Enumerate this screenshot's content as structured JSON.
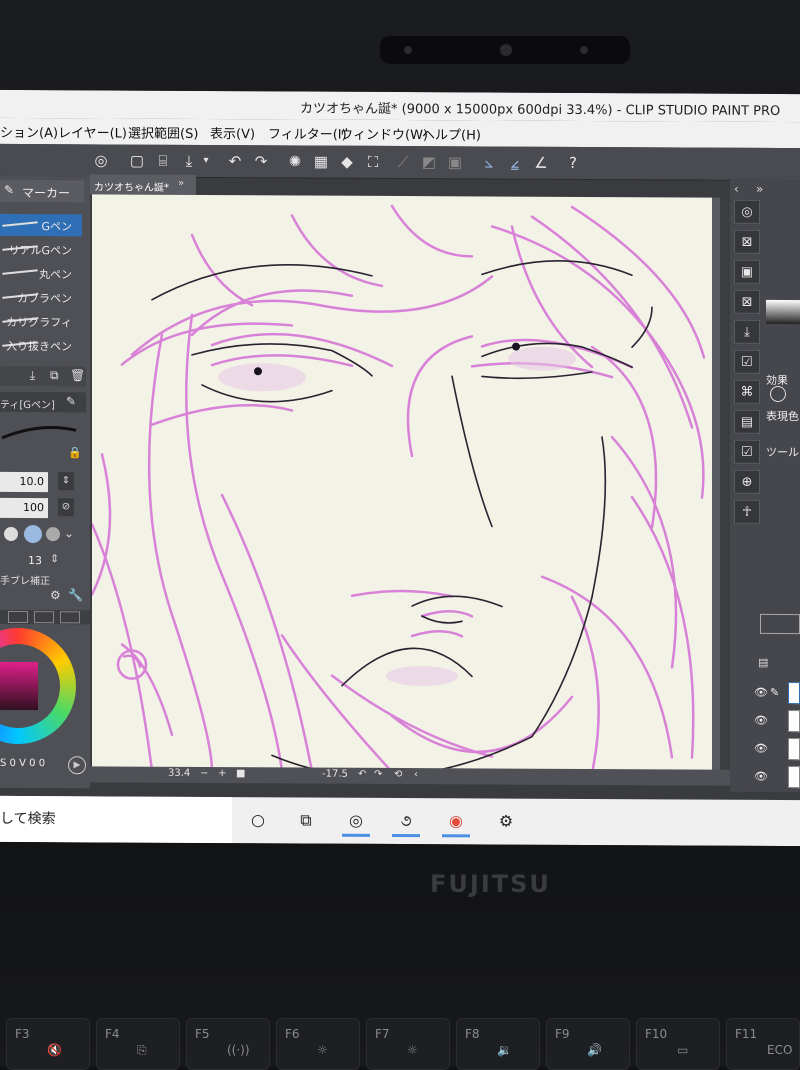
{
  "window": {
    "title": "カツオちゃん誕* (9000 x 15000px 600dpi 33.4%) - CLIP STUDIO PAINT PRO"
  },
  "menu": {
    "items": [
      "ション(A)",
      "レイヤー(L)",
      "選択範囲(S)",
      "表示(V)",
      "フィルター(I)",
      "ウィンドウ(W)",
      "ヘルプ(H)"
    ]
  },
  "left_panel": {
    "tool_group": "マーカー",
    "brushes": [
      "Gペン",
      "リアルGペン",
      "丸ペン",
      "カブラペン",
      "カリグラフィ",
      "入り抜きペン"
    ],
    "selected_brush": "Gペン",
    "property_title": "ティ[Gペン]",
    "brush_size": "10.0",
    "opacity": "100",
    "stabilization": "13",
    "correction_label": "手ブレ補正",
    "color_readout": [
      "S",
      "0",
      "V",
      "0",
      "0"
    ]
  },
  "canvas": {
    "tab_label": "カツオちゃん誕*",
    "tab_close": "»",
    "zoom": "33.4",
    "rotation": "-17.5"
  },
  "right_panel": {
    "labels": [
      "効果",
      "表現色",
      "ツール"
    ]
  },
  "taskbar": {
    "search_text": "して検索"
  },
  "hardware": {
    "brand": "FUJITSU",
    "fkeys": [
      {
        "key": "F3",
        "glyph": "🔇"
      },
      {
        "key": "F4",
        "glyph": "⎘"
      },
      {
        "key": "F5",
        "glyph": "((·))"
      },
      {
        "key": "F6",
        "glyph": "☼"
      },
      {
        "key": "F7",
        "glyph": "☼"
      },
      {
        "key": "F8",
        "glyph": "🔉"
      },
      {
        "key": "F9",
        "glyph": "🔊"
      },
      {
        "key": "F10",
        "glyph": "▭"
      },
      {
        "key": "F11",
        "glyph": "ECO"
      }
    ]
  },
  "colors": {
    "sketch_pink": "#d676d6",
    "line_dark": "#2a2230",
    "canvas_paper": "#f3f2e7",
    "selection_blue": "#2f6fb5"
  }
}
